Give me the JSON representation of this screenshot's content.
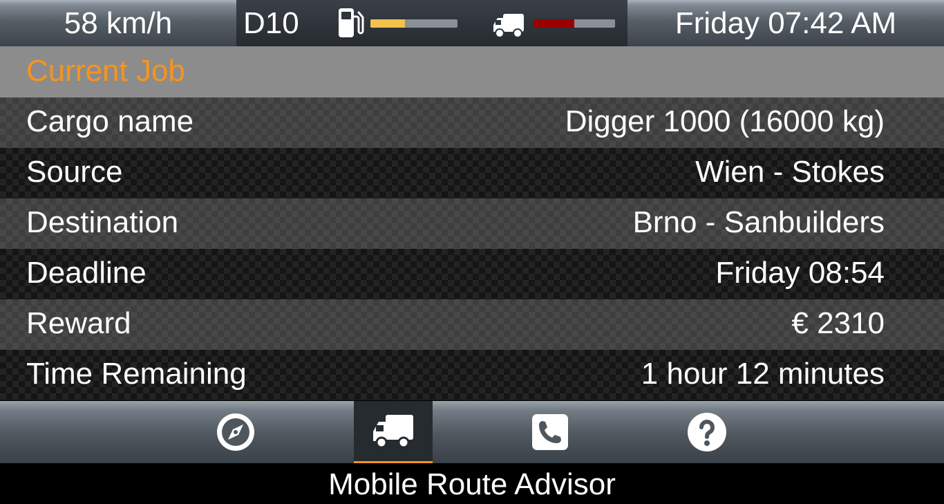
{
  "status_bar": {
    "speed": "58 km/h",
    "gear": "D10",
    "fuel_icon": "fuel-pump-icon",
    "fuel_level": 0.4,
    "fuel_color": "#f2c14e",
    "truck_icon": "truck-icon",
    "damage_level": 0.5,
    "damage_color": "#9b0000",
    "clock": "Friday 07:42 AM"
  },
  "job": {
    "header": "Current Job",
    "header_color": "#f7941d",
    "rows": [
      {
        "label": "Cargo name",
        "value": "Digger 1000 (16000 kg)"
      },
      {
        "label": "Source",
        "value": "Wien - Stokes"
      },
      {
        "label": "Destination",
        "value": "Brno - Sanbuilders"
      },
      {
        "label": "Deadline",
        "value": "Friday 08:54"
      },
      {
        "label": "Reward",
        "value": "€ 2310"
      },
      {
        "label": "Time Remaining",
        "value": "1 hour 12 minutes"
      }
    ]
  },
  "nav": {
    "items": [
      {
        "icon": "compass-icon",
        "active": false
      },
      {
        "icon": "truck-icon",
        "active": true
      },
      {
        "icon": "phone-icon",
        "active": false
      },
      {
        "icon": "help-icon",
        "active": false
      }
    ],
    "accent": "#f7941d"
  },
  "footer": {
    "title": "Mobile Route Advisor"
  }
}
